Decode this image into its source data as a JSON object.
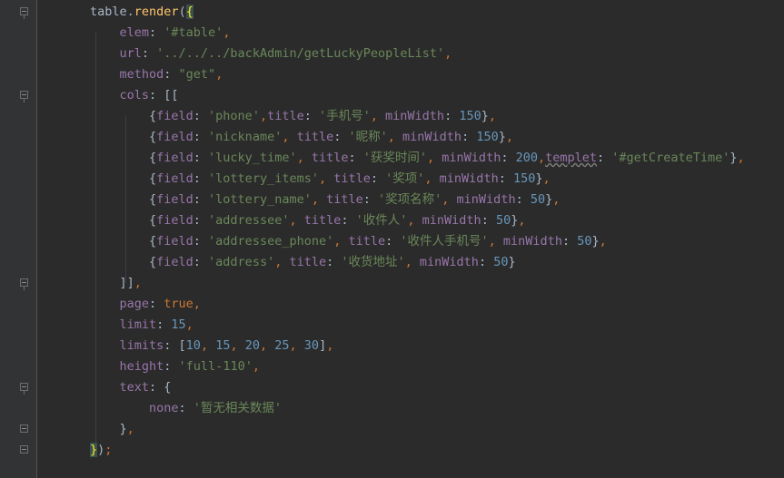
{
  "code": {
    "lines": [
      {
        "indent": 0,
        "tokens": [
          [
            "punc",
            "table."
          ],
          [
            "fn",
            "render"
          ],
          [
            "punc",
            "("
          ],
          [
            "hl",
            "{"
          ]
        ]
      },
      {
        "indent": 1,
        "tokens": [
          [
            "key",
            "elem"
          ],
          [
            "punc",
            ": "
          ],
          [
            "str",
            "'#table'"
          ],
          [
            "kw",
            ","
          ]
        ]
      },
      {
        "indent": 1,
        "tokens": [
          [
            "key",
            "url"
          ],
          [
            "punc",
            ": "
          ],
          [
            "str",
            "'../../../backAdmin/getLuckyPeopleList'"
          ],
          [
            "kw",
            ","
          ]
        ]
      },
      {
        "indent": 1,
        "tokens": [
          [
            "key",
            "method"
          ],
          [
            "punc",
            ": "
          ],
          [
            "str",
            "\"get\""
          ],
          [
            "kw",
            ","
          ]
        ]
      },
      {
        "indent": 1,
        "tokens": [
          [
            "key",
            "cols"
          ],
          [
            "punc",
            ": [["
          ]
        ]
      },
      {
        "indent": 2,
        "tokens": [
          [
            "punc",
            "{"
          ],
          [
            "key",
            "field"
          ],
          [
            "punc",
            ": "
          ],
          [
            "str",
            "'phone'"
          ],
          [
            "kw",
            ","
          ],
          [
            "key",
            "title"
          ],
          [
            "punc",
            ": "
          ],
          [
            "str",
            "'手机号'"
          ],
          [
            "kw",
            ", "
          ],
          [
            "key",
            "minWidth"
          ],
          [
            "punc",
            ": "
          ],
          [
            "num",
            "150"
          ],
          [
            "punc",
            "}"
          ],
          [
            "kw",
            ","
          ]
        ]
      },
      {
        "indent": 2,
        "tokens": [
          [
            "punc",
            "{"
          ],
          [
            "key",
            "field"
          ],
          [
            "punc",
            ": "
          ],
          [
            "str",
            "'nickname'"
          ],
          [
            "kw",
            ", "
          ],
          [
            "key",
            "title"
          ],
          [
            "punc",
            ": "
          ],
          [
            "str",
            "'昵称'"
          ],
          [
            "kw",
            ", "
          ],
          [
            "key",
            "minWidth"
          ],
          [
            "punc",
            ": "
          ],
          [
            "num",
            "150"
          ],
          [
            "punc",
            "}"
          ],
          [
            "kw",
            ","
          ]
        ]
      },
      {
        "indent": 2,
        "tokens": [
          [
            "punc",
            "{"
          ],
          [
            "key",
            "field"
          ],
          [
            "punc",
            ": "
          ],
          [
            "str",
            "'lucky_time'"
          ],
          [
            "kw",
            ", "
          ],
          [
            "key",
            "title"
          ],
          [
            "punc",
            ": "
          ],
          [
            "str",
            "'获奖时间'"
          ],
          [
            "kw",
            ", "
          ],
          [
            "key",
            "minWidth"
          ],
          [
            "punc",
            ": "
          ],
          [
            "num",
            "200"
          ],
          [
            "kw",
            ","
          ],
          [
            "warnkey",
            "templet"
          ],
          [
            "punc",
            ": "
          ],
          [
            "str",
            "'#getCreateTime'"
          ],
          [
            "punc",
            "}"
          ],
          [
            "kw",
            ","
          ]
        ]
      },
      {
        "indent": 2,
        "tokens": [
          [
            "punc",
            "{"
          ],
          [
            "key",
            "field"
          ],
          [
            "punc",
            ": "
          ],
          [
            "str",
            "'lottery_items'"
          ],
          [
            "kw",
            ", "
          ],
          [
            "key",
            "title"
          ],
          [
            "punc",
            ": "
          ],
          [
            "str",
            "'奖项'"
          ],
          [
            "kw",
            ", "
          ],
          [
            "key",
            "minWidth"
          ],
          [
            "punc",
            ": "
          ],
          [
            "num",
            "150"
          ],
          [
            "punc",
            "}"
          ],
          [
            "kw",
            ","
          ]
        ]
      },
      {
        "indent": 2,
        "tokens": [
          [
            "punc",
            "{"
          ],
          [
            "key",
            "field"
          ],
          [
            "punc",
            ": "
          ],
          [
            "str",
            "'lottery_name'"
          ],
          [
            "kw",
            ", "
          ],
          [
            "key",
            "title"
          ],
          [
            "punc",
            ": "
          ],
          [
            "str",
            "'奖项名称'"
          ],
          [
            "kw",
            ", "
          ],
          [
            "key",
            "minWidth"
          ],
          [
            "punc",
            ": "
          ],
          [
            "num",
            "50"
          ],
          [
            "punc",
            "}"
          ],
          [
            "kw",
            ","
          ]
        ]
      },
      {
        "indent": 2,
        "tokens": [
          [
            "punc",
            "{"
          ],
          [
            "key",
            "field"
          ],
          [
            "punc",
            ": "
          ],
          [
            "str",
            "'addressee'"
          ],
          [
            "kw",
            ", "
          ],
          [
            "key",
            "title"
          ],
          [
            "punc",
            ": "
          ],
          [
            "str",
            "'收件人'"
          ],
          [
            "kw",
            ", "
          ],
          [
            "key",
            "minWidth"
          ],
          [
            "punc",
            ": "
          ],
          [
            "num",
            "50"
          ],
          [
            "punc",
            "}"
          ],
          [
            "kw",
            ","
          ]
        ]
      },
      {
        "indent": 2,
        "tokens": [
          [
            "punc",
            "{"
          ],
          [
            "key",
            "field"
          ],
          [
            "punc",
            ": "
          ],
          [
            "str",
            "'addressee_phone'"
          ],
          [
            "kw",
            ", "
          ],
          [
            "key",
            "title"
          ],
          [
            "punc",
            ": "
          ],
          [
            "str",
            "'收件人手机号'"
          ],
          [
            "kw",
            ", "
          ],
          [
            "key",
            "minWidth"
          ],
          [
            "punc",
            ": "
          ],
          [
            "num",
            "50"
          ],
          [
            "punc",
            "}"
          ],
          [
            "kw",
            ","
          ]
        ]
      },
      {
        "indent": 2,
        "tokens": [
          [
            "punc",
            "{"
          ],
          [
            "key",
            "field"
          ],
          [
            "punc",
            ": "
          ],
          [
            "str",
            "'address'"
          ],
          [
            "kw",
            ", "
          ],
          [
            "key",
            "title"
          ],
          [
            "punc",
            ": "
          ],
          [
            "str",
            "'收货地址'"
          ],
          [
            "kw",
            ", "
          ],
          [
            "key",
            "minWidth"
          ],
          [
            "punc",
            ": "
          ],
          [
            "num",
            "50"
          ],
          [
            "punc",
            "}"
          ]
        ]
      },
      {
        "indent": 1,
        "tokens": [
          [
            "punc",
            "]]"
          ],
          [
            "kw",
            ","
          ]
        ]
      },
      {
        "indent": 1,
        "tokens": [
          [
            "key",
            "page"
          ],
          [
            "punc",
            ": "
          ],
          [
            "kw",
            "true"
          ],
          [
            "kw",
            ","
          ]
        ]
      },
      {
        "indent": 1,
        "tokens": [
          [
            "key",
            "limit"
          ],
          [
            "punc",
            ": "
          ],
          [
            "num",
            "15"
          ],
          [
            "kw",
            ","
          ]
        ]
      },
      {
        "indent": 1,
        "tokens": [
          [
            "key",
            "limits"
          ],
          [
            "punc",
            ": ["
          ],
          [
            "num",
            "10"
          ],
          [
            "kw",
            ", "
          ],
          [
            "num",
            "15"
          ],
          [
            "kw",
            ", "
          ],
          [
            "num",
            "20"
          ],
          [
            "kw",
            ", "
          ],
          [
            "num",
            "25"
          ],
          [
            "kw",
            ", "
          ],
          [
            "num",
            "30"
          ],
          [
            "punc",
            "]"
          ],
          [
            "kw",
            ","
          ]
        ]
      },
      {
        "indent": 1,
        "tokens": [
          [
            "key",
            "height"
          ],
          [
            "punc",
            ": "
          ],
          [
            "str",
            "'full-110'"
          ],
          [
            "kw",
            ","
          ]
        ]
      },
      {
        "indent": 1,
        "tokens": [
          [
            "key",
            "text"
          ],
          [
            "punc",
            ": {"
          ]
        ]
      },
      {
        "indent": 2,
        "tokens": [
          [
            "key",
            "none"
          ],
          [
            "punc",
            ": "
          ],
          [
            "str",
            "'暂无相关数据'"
          ]
        ]
      },
      {
        "indent": 1,
        "tokens": [
          [
            "punc",
            "}"
          ],
          [
            "kw",
            ","
          ]
        ]
      },
      {
        "indent": 0,
        "tokens": [
          [
            "hl",
            "}"
          ],
          [
            "punc",
            ")"
          ],
          [
            "kw",
            ";"
          ]
        ]
      }
    ],
    "fold_lines": [
      0,
      4,
      13,
      18,
      20,
      21
    ]
  },
  "colors": {
    "background": "#2b2b2b",
    "gutter": "#313335",
    "keyword": "#cc7832",
    "string": "#6a8759",
    "number": "#6897bb",
    "property": "#9876aa",
    "function": "#ffc66d",
    "text": "#a9b7c6"
  }
}
